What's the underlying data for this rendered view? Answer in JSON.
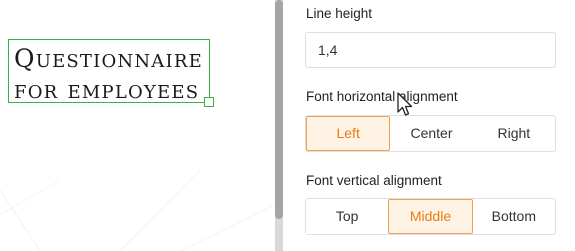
{
  "canvas": {
    "textbox_text": "Questionnaire for employees",
    "selection_color": "#3cb043"
  },
  "panel": {
    "line_height": {
      "label": "Line height",
      "value": "1,4"
    },
    "horizontal_alignment": {
      "label": "Font horizontal alignment",
      "options": [
        "Left",
        "Center",
        "Right"
      ],
      "selected": "Left"
    },
    "vertical_alignment": {
      "label": "Font vertical alignment",
      "options": [
        "Top",
        "Middle",
        "Bottom"
      ],
      "selected": "Middle"
    }
  },
  "colors": {
    "accent": "#ea7b12",
    "accent_bg": "#fff3e6",
    "accent_border": "#f0a050"
  },
  "cursor": {
    "icon": "mouse-pointer-icon"
  }
}
